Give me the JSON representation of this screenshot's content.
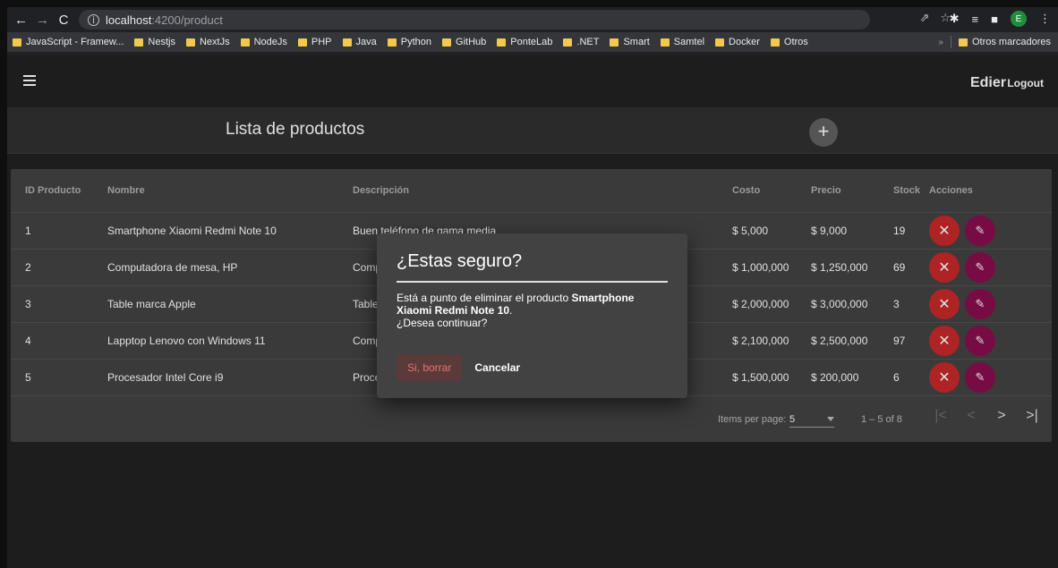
{
  "browser": {
    "url_host": "localhost",
    "url_path": ":4200/product",
    "bookmarks": [
      "JavaScript - Framew...",
      "Nestjs",
      "NextJs",
      "NodeJs",
      "PHP",
      "Java",
      "Python",
      "GitHub",
      "PonteLab",
      ".NET",
      "Smart",
      "Samtel",
      "Docker",
      "Otros"
    ],
    "other_bookmarks": "Otros marcadores",
    "profile_initial": "E"
  },
  "app": {
    "user_name": "Edier",
    "logout_label": "Logout",
    "page_title": "Lista de productos"
  },
  "table": {
    "headers": {
      "id": "ID Producto",
      "name": "Nombre",
      "desc": "Descripción",
      "cost": "Costo",
      "price": "Precio",
      "stock": "Stock",
      "actions": "Acciones"
    },
    "rows": [
      {
        "id": "1",
        "name": "Smartphone Xiaomi Redmi Note 10",
        "desc": "Buen teléfono de gama media",
        "cost": "$ 5,000",
        "price": "$ 9,000",
        "stock": "19"
      },
      {
        "id": "2",
        "name": "Computadora de mesa, HP",
        "desc": "Comp",
        "cost": "$ 1,000,000",
        "price": "$ 1,250,000",
        "stock": "69"
      },
      {
        "id": "3",
        "name": "Table marca Apple",
        "desc": "Table",
        "cost": "$ 2,000,000",
        "price": "$ 3,000,000",
        "stock": "3"
      },
      {
        "id": "4",
        "name": "Lapptop Lenovo con Windows 11",
        "desc": "Comp",
        "cost": "$ 2,100,000",
        "price": "$ 2,500,000",
        "stock": "97"
      },
      {
        "id": "5",
        "name": "Procesador Intel Core i9",
        "desc": "Proce",
        "cost": "$ 1,500,000",
        "price": "$ 200,000",
        "stock": "6"
      }
    ]
  },
  "paginator": {
    "label": "Items per page:",
    "page_size": "5",
    "range": "1 – 5 of 8"
  },
  "dialog": {
    "title": "¿Estas seguro?",
    "body_prefix": "Está a punto de eliminar el producto ",
    "product_name": "Smartphone Xiaomi Redmi Note 10",
    "body_suffix": ".",
    "question": "¿Desea continuar?",
    "confirm_label": "Si, borrar",
    "cancel_label": "Cancelar"
  },
  "colors": {
    "delete_button": "#c62828",
    "edit_button": "#880e4f",
    "confirm_text": "#e57373"
  }
}
